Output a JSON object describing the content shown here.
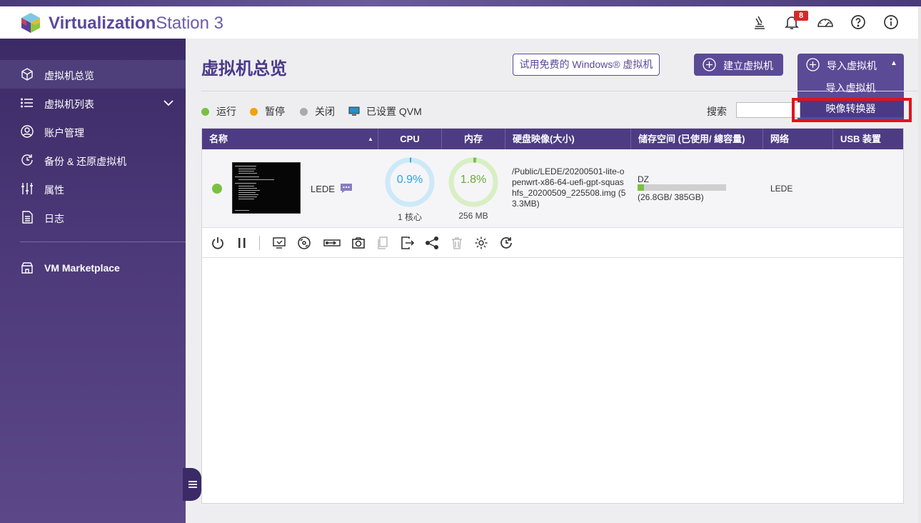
{
  "app": {
    "title_part1": "Virtualization",
    "title_part2": "Station 3",
    "notifications_count": "8"
  },
  "sidebar": {
    "items": [
      {
        "label": "虚拟机总览",
        "icon": "overview-icon",
        "active": true
      },
      {
        "label": "虚拟机列表",
        "icon": "list-icon",
        "expandable": true
      },
      {
        "label": "账户管理",
        "icon": "account-icon"
      },
      {
        "label": "备份 & 还原虚拟机",
        "icon": "backup-icon"
      },
      {
        "label": "属性",
        "icon": "properties-icon"
      },
      {
        "label": "日志",
        "icon": "log-icon"
      },
      {
        "label": "VM Marketplace",
        "icon": "marketplace-icon"
      }
    ]
  },
  "main": {
    "page_title": "虚拟机总览",
    "trial_button": "试用免费的 Windows® 虚拟机",
    "create_button": "建立虚拟机",
    "import_button": "导入虚拟机",
    "import_menu": [
      "导入虚拟机",
      "映像转换器"
    ],
    "legend": {
      "running": "运行",
      "paused": "暂停",
      "off": "关闭",
      "qvm": "已设置 QVM"
    },
    "search_label": "搜索",
    "search_value": ""
  },
  "table": {
    "columns": [
      "名称",
      "CPU",
      "内存",
      "硬盘映像(大小)",
      "储存空间 (已使用/ 總容量)",
      "网络",
      "USB 装置"
    ],
    "rows": [
      {
        "name": "LEDE",
        "status": "running",
        "cpu_percent": "0.9%",
        "cpu_cores": "1 核心",
        "memory_percent": "1.8%",
        "memory_size": "256 MB",
        "disk_image": "/Public/LEDE/20200501-lite-openwrt-x86-64-uefi-gpt-squashfs_20200509_225508.img (53.3MB)",
        "storage_name": "DZ",
        "storage_used": "(26.8GB/ 385GB)",
        "storage_fraction": 0.07,
        "network": "LEDE",
        "usb": ""
      }
    ]
  },
  "colors": {
    "accent": "#5b4a96",
    "running": "#7bc043",
    "paused": "#f0a30a",
    "off": "#aaaaaa",
    "cpu_gauge": "#29a6e0",
    "mem_gauge": "#7bc043",
    "highlight_box": "#e3121c"
  }
}
